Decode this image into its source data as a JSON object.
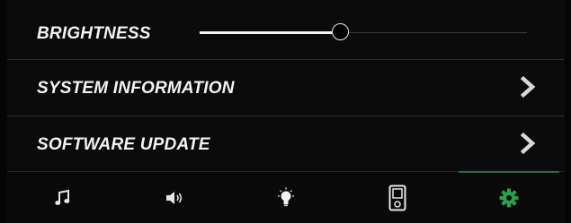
{
  "settings": {
    "brightness": {
      "label": "BRIGHTNESS",
      "value": 0.43
    },
    "rows": [
      {
        "label": "SYSTEM INFORMATION",
        "icon": "chevron-right-icon"
      },
      {
        "label": "SOFTWARE UPDATE",
        "icon": "chevron-right-icon"
      }
    ]
  },
  "tabs": [
    {
      "name": "music",
      "icon": "music-note-icon",
      "active": false
    },
    {
      "name": "volume",
      "icon": "speaker-icon",
      "active": false
    },
    {
      "name": "lighting",
      "icon": "light-bulb-icon",
      "active": false
    },
    {
      "name": "device",
      "icon": "device-icon",
      "active": false
    },
    {
      "name": "settings",
      "icon": "gear-icon",
      "active": true
    }
  ],
  "colors": {
    "background": "#0b0b0b",
    "text": "#f2f2f2",
    "divider": "#2d2d2d",
    "active_icon": "#2e9f4f",
    "inactive_icon": "#e0e0e0"
  }
}
